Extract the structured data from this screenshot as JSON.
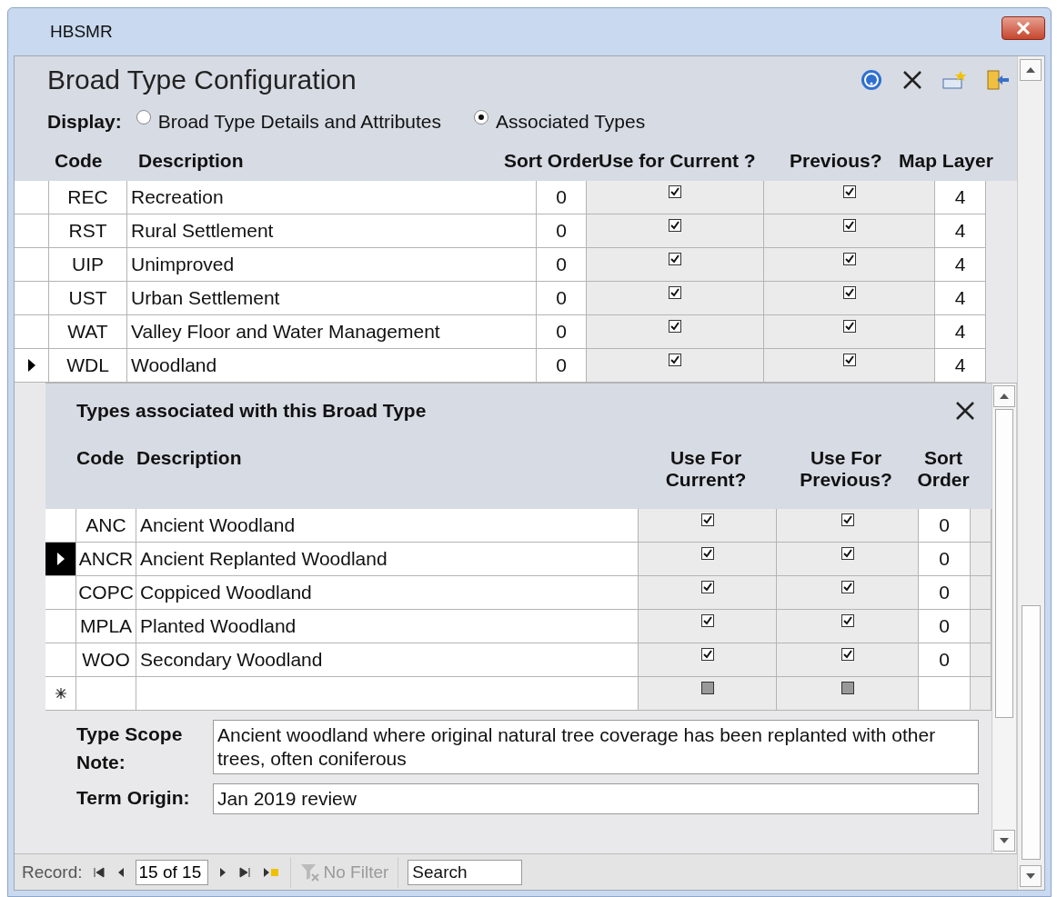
{
  "window": {
    "title": "HBSMR"
  },
  "form": {
    "title": "Broad Type Configuration",
    "display_label": "Display:",
    "display_options": [
      {
        "label": "Broad Type Details and Attributes",
        "selected": false
      },
      {
        "label": "Associated Types",
        "selected": true
      }
    ]
  },
  "broad_types": {
    "columns": [
      "Code",
      "Description",
      "Sort Order",
      "Use for Current ?",
      "Previous?",
      "Map Layer"
    ],
    "rows": [
      {
        "code": "REC",
        "description": "Recreation",
        "sort_order": "0",
        "current": true,
        "previous": true,
        "map_layer": "4",
        "selected": false
      },
      {
        "code": "RST",
        "description": "Rural Settlement",
        "sort_order": "0",
        "current": true,
        "previous": true,
        "map_layer": "4",
        "selected": false
      },
      {
        "code": "UIP",
        "description": "Unimproved",
        "sort_order": "0",
        "current": true,
        "previous": true,
        "map_layer": "4",
        "selected": false
      },
      {
        "code": "UST",
        "description": "Urban Settlement",
        "sort_order": "0",
        "current": true,
        "previous": true,
        "map_layer": "4",
        "selected": false
      },
      {
        "code": "WAT",
        "description": "Valley Floor and Water Management",
        "sort_order": "0",
        "current": true,
        "previous": true,
        "map_layer": "4",
        "selected": false
      },
      {
        "code": "WDL",
        "description": "Woodland",
        "sort_order": "0",
        "current": true,
        "previous": true,
        "map_layer": "4",
        "selected": true
      }
    ]
  },
  "associated_types": {
    "title": "Types associated with this Broad Type",
    "columns": [
      "Code",
      "Description",
      "Use For Current?",
      "Use For Previous?",
      "Sort Order"
    ],
    "rows": [
      {
        "kind": "record",
        "code": "ANC",
        "description": "Ancient Woodland",
        "current": true,
        "previous": true,
        "sort_order": "0",
        "selected": false
      },
      {
        "kind": "record",
        "code": "ANCR",
        "description": "Ancient Replanted Woodland",
        "current": true,
        "previous": true,
        "sort_order": "0",
        "selected": true
      },
      {
        "kind": "record",
        "code": "COPC",
        "description": "Coppiced Woodland",
        "current": true,
        "previous": true,
        "sort_order": "0",
        "selected": false
      },
      {
        "kind": "record",
        "code": "MPLA",
        "description": "Planted Woodland",
        "current": true,
        "previous": true,
        "sort_order": "0",
        "selected": false
      },
      {
        "kind": "record",
        "code": "WOO",
        "description": "Secondary Woodland",
        "current": true,
        "previous": true,
        "sort_order": "0",
        "selected": false
      },
      {
        "kind": "new",
        "current": null,
        "previous": null,
        "selected": false
      }
    ]
  },
  "scope_note": {
    "label": "Type Scope Note:",
    "value": "Ancient woodland where original natural tree coverage has been replanted with other trees, often coniferous"
  },
  "term_origin": {
    "label": "Term Origin:",
    "value": "Jan 2019 review"
  },
  "record_nav": {
    "label": "Record:",
    "position": "15 of 15",
    "filter": "No Filter",
    "filter_disabled": true,
    "search_placeholder": "Search"
  }
}
